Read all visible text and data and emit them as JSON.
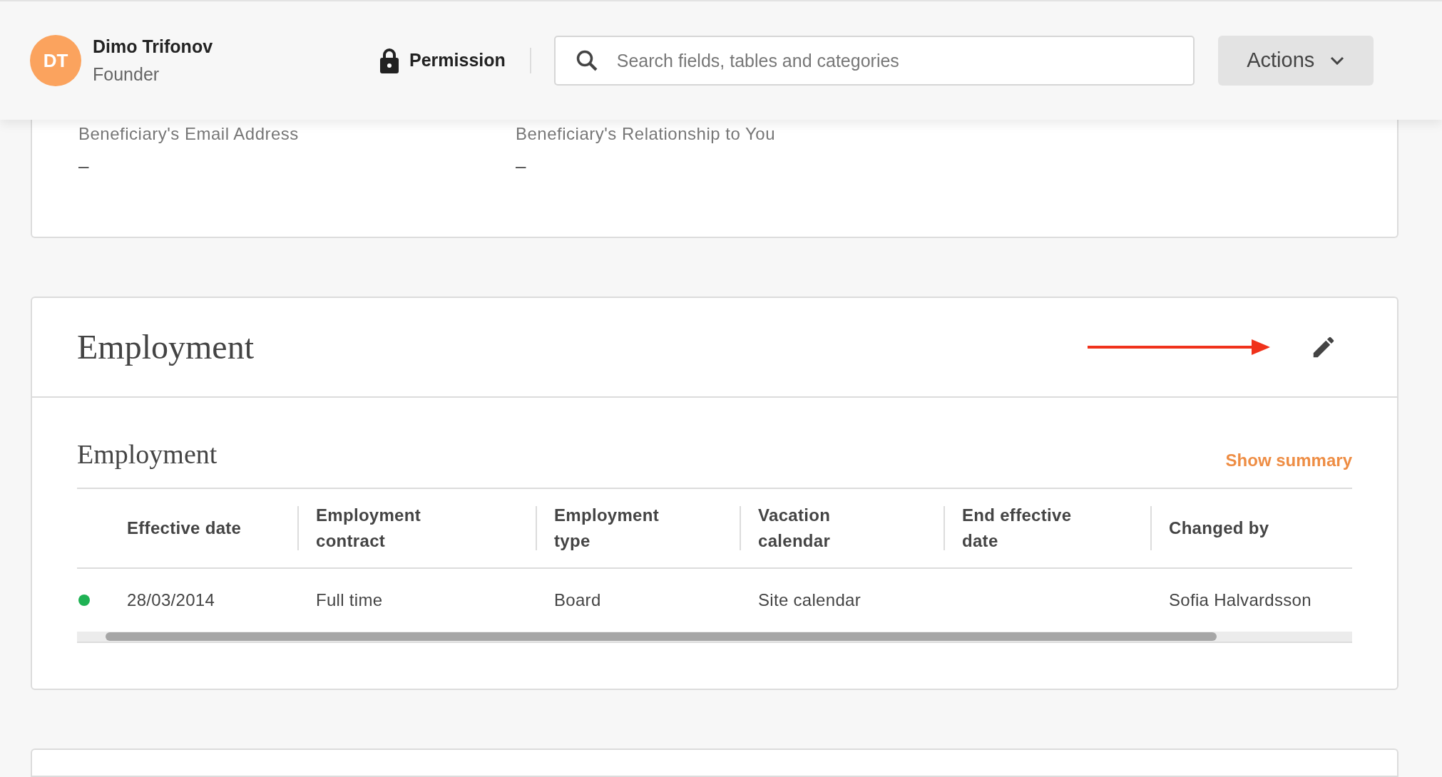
{
  "header": {
    "user": {
      "initials": "DT",
      "name": "Dimo Trifonov",
      "role": "Founder"
    },
    "permission": "Permission",
    "search": {
      "placeholder": "Search fields, tables and categories"
    },
    "actions": "Actions"
  },
  "beneficiary_card": {
    "fields": [
      {
        "label": "Beneficiary's Email Address",
        "value": "–"
      },
      {
        "label": "Beneficiary's Relationship to You",
        "value": "–"
      }
    ]
  },
  "employment_card": {
    "title": "Employment",
    "section_title": "Employment",
    "show_summary": "Show summary",
    "table": {
      "columns": [
        "Effective date",
        "Employment contract",
        "Employment type",
        "Vacation calendar",
        "End effective date",
        "Changed by"
      ],
      "rows": [
        {
          "color": "#1fb254",
          "cells": [
            "28/03/2014",
            "Full time",
            "Board",
            "Site calendar",
            null,
            "Sofia Halvardsson"
          ]
        }
      ]
    }
  }
}
